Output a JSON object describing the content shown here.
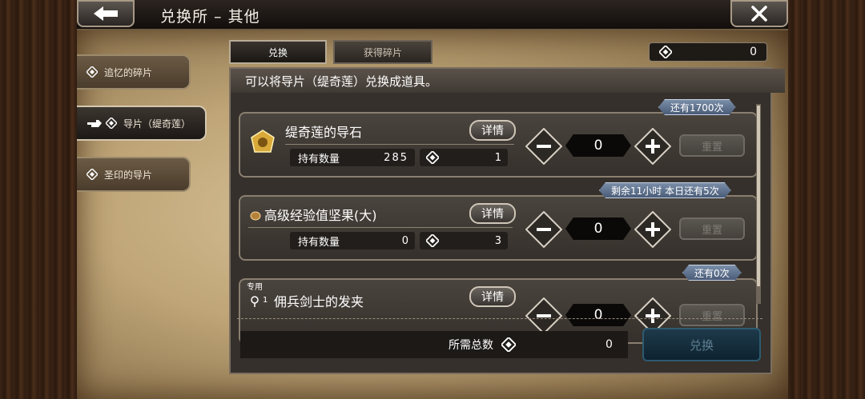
{
  "header": {
    "title": "兑换所 – 其他"
  },
  "sidebar": {
    "items": [
      {
        "label": "追忆的碎片"
      },
      {
        "label": "导片（缇奇莲）"
      },
      {
        "label": "圣印的导片"
      }
    ]
  },
  "tabs": [
    {
      "label": "兑换"
    },
    {
      "label": "获得碎片"
    }
  ],
  "currency": {
    "value": "0"
  },
  "panel": {
    "description": "可以将导片（缇奇莲）兑换成道具。"
  },
  "items": [
    {
      "name": "缇奇莲的导石",
      "detail_label": "详情",
      "hold_label": "持有数量",
      "hold_value": "285",
      "cost": "1",
      "quantity": "0",
      "reset_label": "重置",
      "badge": "还有1700次"
    },
    {
      "name": "高级经验值坚果(大)",
      "detail_label": "详情",
      "hold_label": "持有数量",
      "hold_value": "0",
      "cost": "3",
      "quantity": "0",
      "reset_label": "重置",
      "badge": "剩余11小时  本日还有5次"
    },
    {
      "name": "佣兵剑士的发夹",
      "tag": "专用",
      "rank": "1",
      "detail_label": "详情",
      "quantity": "0",
      "reset_label": "重置",
      "badge": "还有0次"
    }
  ],
  "footer": {
    "total_label": "所需总数",
    "total_value": "0",
    "exchange_label": "兑换"
  },
  "colors": {
    "accent_badge": "#5a6e8c",
    "exchange_button": "#16303e"
  },
  "icons": [
    "back-arrow-icon",
    "close-icon",
    "diamond-icon",
    "pointing-hand-icon",
    "minus-icon",
    "plus-icon",
    "gold-stone-icon",
    "nut-icon",
    "hairpin-icon"
  ]
}
